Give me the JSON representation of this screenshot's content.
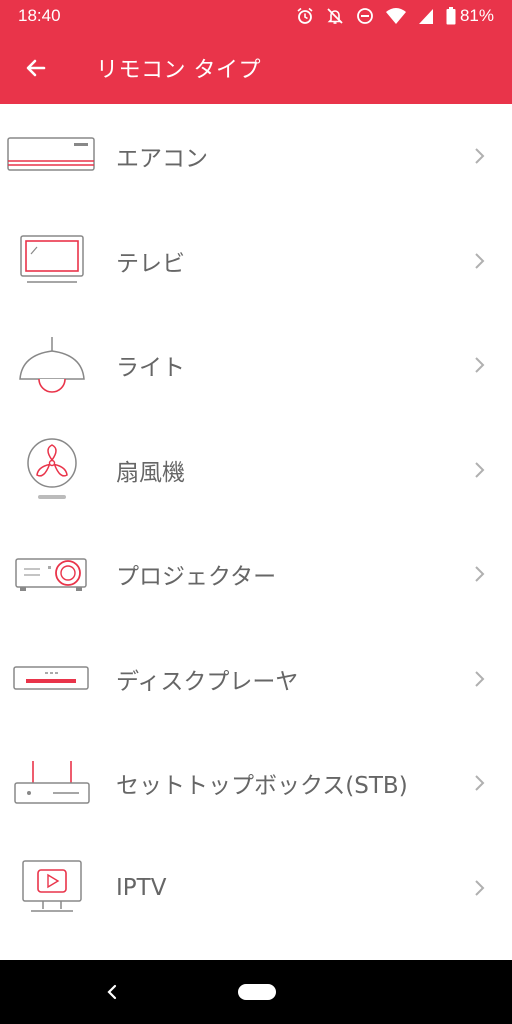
{
  "status_bar": {
    "time": "18:40",
    "battery": "81%",
    "icons": [
      "alarm-icon",
      "notifications-off-icon",
      "do-not-disturb-icon",
      "wifi-icon",
      "signal-icon",
      "battery-icon"
    ]
  },
  "header": {
    "title": "リモコン タイプ",
    "back_icon": "arrow-back-icon"
  },
  "colors": {
    "accent": "#e9344a",
    "text": "#666666",
    "chevron": "#b0b0b0"
  },
  "remote_types": [
    {
      "label": "エアコン",
      "icon": "air-conditioner-icon"
    },
    {
      "label": "テレビ",
      "icon": "tv-icon"
    },
    {
      "label": "ライト",
      "icon": "light-icon"
    },
    {
      "label": "扇風機",
      "icon": "fan-icon"
    },
    {
      "label": "プロジェクター",
      "icon": "projector-icon"
    },
    {
      "label": "ディスクプレーヤ",
      "icon": "disc-player-icon"
    },
    {
      "label": "セットトップボックス(STB)",
      "icon": "set-top-box-icon"
    },
    {
      "label": "IPTV",
      "icon": "iptv-icon"
    }
  ]
}
